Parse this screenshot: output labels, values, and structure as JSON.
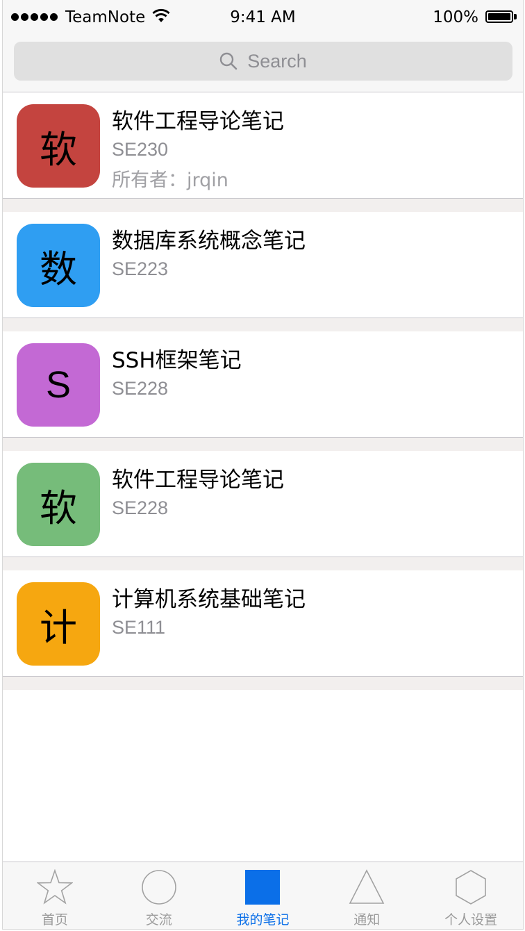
{
  "status_bar": {
    "carrier": "TeamNote",
    "time": "9:41 AM",
    "battery": "100%"
  },
  "search": {
    "placeholder": "Search"
  },
  "notes": [
    {
      "avatar_char": "软",
      "avatar_color": "#c4443f",
      "title": "软件工程导论笔记",
      "code": "SE230",
      "owner": "所有者：jrqin"
    },
    {
      "avatar_char": "数",
      "avatar_color": "#2f9ef2",
      "title": "数据库系统概念笔记",
      "code": "SE223"
    },
    {
      "avatar_char": "S",
      "avatar_color": "#c369d4",
      "title": "SSH框架笔记",
      "code": "SE228"
    },
    {
      "avatar_char": "软",
      "avatar_color": "#76bc7a",
      "title": "软件工程导论笔记",
      "code": "SE228"
    },
    {
      "avatar_char": "计",
      "avatar_color": "#f6a710",
      "title": "计算机系统基础笔记",
      "code": "SE111"
    }
  ],
  "tabs": [
    {
      "label": "首页",
      "icon": "star-icon"
    },
    {
      "label": "交流",
      "icon": "circle-icon"
    },
    {
      "label": "我的笔记",
      "icon": "square-icon",
      "active": true
    },
    {
      "label": "通知",
      "icon": "triangle-icon"
    },
    {
      "label": "个人设置",
      "icon": "hexagon-icon"
    }
  ],
  "colors": {
    "accent": "#0b6fe8",
    "separator_bg": "#f2efee"
  }
}
